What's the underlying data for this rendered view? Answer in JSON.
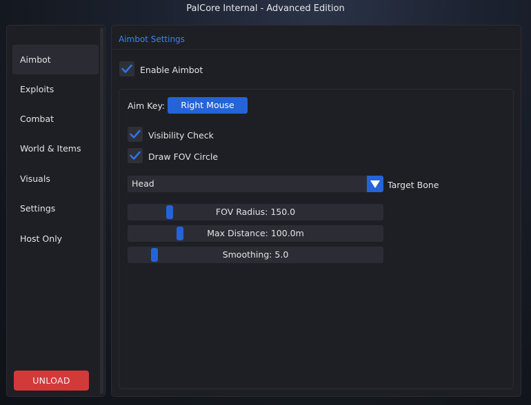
{
  "window": {
    "title": "PalCore Internal - Advanced Edition"
  },
  "sidebar": {
    "items": [
      {
        "label": "Aimbot",
        "active": true
      },
      {
        "label": "Exploits"
      },
      {
        "label": "Combat"
      },
      {
        "label": "World & Items"
      },
      {
        "label": "Visuals"
      },
      {
        "label": "Settings"
      },
      {
        "label": "Host Only"
      }
    ],
    "unload_label": "UNLOAD"
  },
  "main": {
    "section_title": "Aimbot Settings",
    "enable_aimbot": {
      "label": "Enable Aimbot",
      "checked": true
    },
    "aim_key": {
      "label": "Aim Key:",
      "value": "Right Mouse"
    },
    "visibility_check": {
      "label": "Visibility Check",
      "checked": true
    },
    "draw_fov": {
      "label": "Draw FOV Circle",
      "checked": true
    },
    "target_bone": {
      "value": "Head",
      "label": "Target Bone"
    },
    "sliders": [
      {
        "label": "FOV Radius: 150.0",
        "fraction": 0.155
      },
      {
        "label": "Max Distance: 100.0m",
        "fraction": 0.198
      },
      {
        "label": "Smoothing: 5.0",
        "fraction": 0.095
      }
    ]
  },
  "colors": {
    "accent": "#2563d8",
    "section_title": "#3b82f6",
    "unload": "#d23a3a",
    "panel": "#1e1f24"
  }
}
